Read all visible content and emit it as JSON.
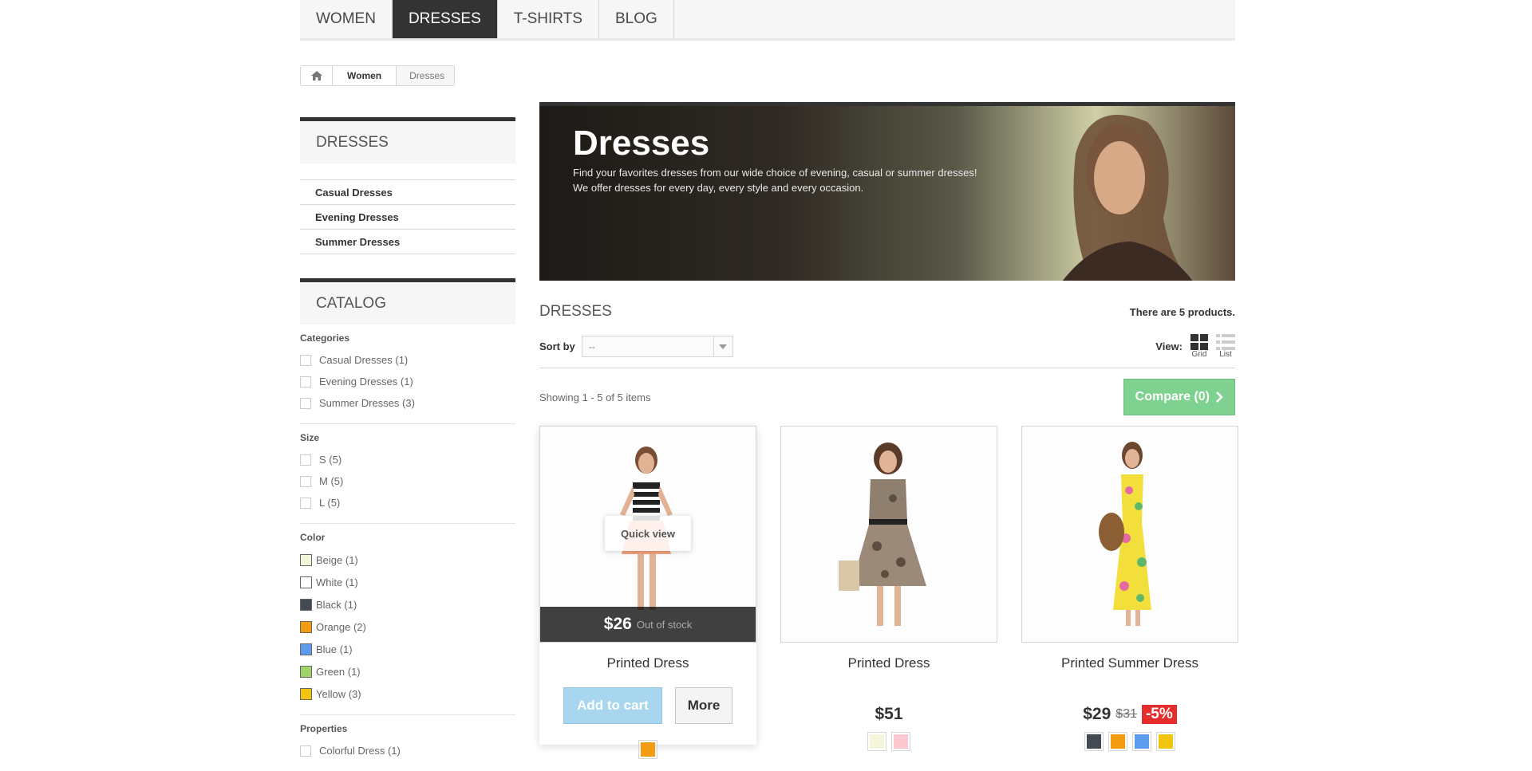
{
  "topnav": {
    "items": [
      {
        "label": "WOMEN",
        "active": false
      },
      {
        "label": "DRESSES",
        "active": true
      },
      {
        "label": "T-SHIRTS",
        "active": false
      },
      {
        "label": "BLOG",
        "active": false
      }
    ]
  },
  "breadcrumb": {
    "home_icon": "home-icon",
    "items": [
      "Women"
    ],
    "current": "Dresses"
  },
  "sidebar": {
    "dresses_title": "DRESSES",
    "dresses_items": [
      "Casual Dresses",
      "Evening Dresses",
      "Summer Dresses"
    ],
    "catalog_title": "CATALOG",
    "groups": {
      "categories": {
        "title": "Categories",
        "items": [
          "Casual Dresses (1)",
          "Evening Dresses (1)",
          "Summer Dresses (3)"
        ]
      },
      "size": {
        "title": "Size",
        "items": [
          "S (5)",
          "M (5)",
          "L (5)"
        ]
      },
      "color": {
        "title": "Color",
        "items": [
          {
            "label": "Beige (1)",
            "color": "#f5f5dc"
          },
          {
            "label": "White (1)",
            "color": "#ffffff"
          },
          {
            "label": "Black (1)",
            "color": "#434a54"
          },
          {
            "label": "Orange (2)",
            "color": "#f39c11"
          },
          {
            "label": "Blue (1)",
            "color": "#5d9cec"
          },
          {
            "label": "Green (1)",
            "color": "#a0d468"
          },
          {
            "label": "Yellow (3)",
            "color": "#f1c40f"
          }
        ]
      },
      "properties": {
        "title": "Properties",
        "items": [
          "Colorful Dress (1)"
        ]
      }
    }
  },
  "banner": {
    "title": "Dresses",
    "description_line1": "Find your favorites dresses from our wide choice of evening, casual or summer dresses!",
    "description_line2": "We offer dresses for every day, every style and every occasion."
  },
  "listing": {
    "heading": "DRESSES",
    "product_count": "There are 5 products.",
    "sort_label": "Sort by",
    "sort_value": "--",
    "view_label": "View:",
    "view_grid": "Grid",
    "view_list": "List",
    "showing": "Showing 1 - 5 of 5 items",
    "compare": "Compare (0)"
  },
  "products": [
    {
      "name": "Printed Dress",
      "price": "$26",
      "stock": "Out of stock",
      "quick_view": "Quick view",
      "add_to_cart": "Add to cart",
      "more": "More",
      "colors": [
        "#f39c11"
      ]
    },
    {
      "name": "Printed Dress",
      "price": "$51",
      "colors": [
        "#f5f5dc",
        "#fcc8d0"
      ]
    },
    {
      "name": "Printed Summer Dress",
      "price": "$29",
      "old_price": "$31",
      "discount": "-5%",
      "colors": [
        "#434a54",
        "#f39c11",
        "#5d9cec",
        "#f1c40f"
      ]
    }
  ],
  "colors": {
    "dark": "#333333",
    "compare_green": "#7fd190",
    "add_to_cart_blue": "#a7d6ee",
    "discount_red": "#e52d2d"
  }
}
